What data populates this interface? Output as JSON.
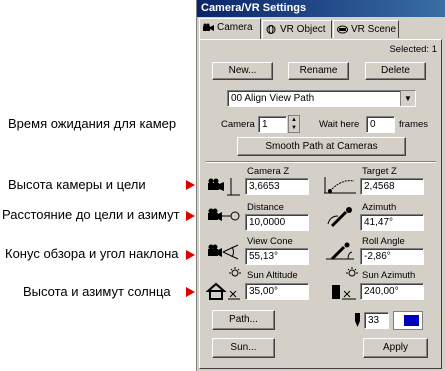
{
  "annotations": [
    "Время ожидания для камер",
    "Высота камеры и цели",
    "Расстояние до цели и азимут",
    "Конус обзора и угол наклона",
    "Высота и азимут солнца"
  ],
  "window": {
    "title": "Camera/VR Settings"
  },
  "tabs": [
    "Camera",
    "VR Object",
    "VR Scene"
  ],
  "selected_label": "Selected: 1",
  "buttons": {
    "new": "New...",
    "rename": "Rename",
    "delete": "Delete",
    "smooth": "Smooth Path at Cameras",
    "path": "Path...",
    "sun": "Sun...",
    "apply": "Apply"
  },
  "camera_select": "00  Align View Path",
  "camera_row": {
    "label": "Camera",
    "value": "1",
    "wait_label": "Wait here",
    "wait_value": "0",
    "frames_label": "frames"
  },
  "fields": {
    "camera_z": {
      "label": "Camera Z",
      "value": "3,6653"
    },
    "target_z": {
      "label": "Target Z",
      "value": "2,4568"
    },
    "distance": {
      "label": "Distance",
      "value": "10,0000"
    },
    "azimuth": {
      "label": "Azimuth",
      "value": "41,47°"
    },
    "view_cone": {
      "label": "View Cone",
      "value": "55,13°"
    },
    "roll_angle": {
      "label": "Roll Angle",
      "value": "-2,86°"
    },
    "sun_altitude": {
      "label": "Sun Altitude",
      "value": "35,00°"
    },
    "sun_azimuth": {
      "label": "Sun Azimuth",
      "value": "240,00°"
    }
  },
  "pen_value": "33",
  "colors": {
    "accent": "#e00000",
    "title_start": "#0a246a",
    "title_end": "#3a6ea5",
    "swatch": "#0000c0"
  }
}
